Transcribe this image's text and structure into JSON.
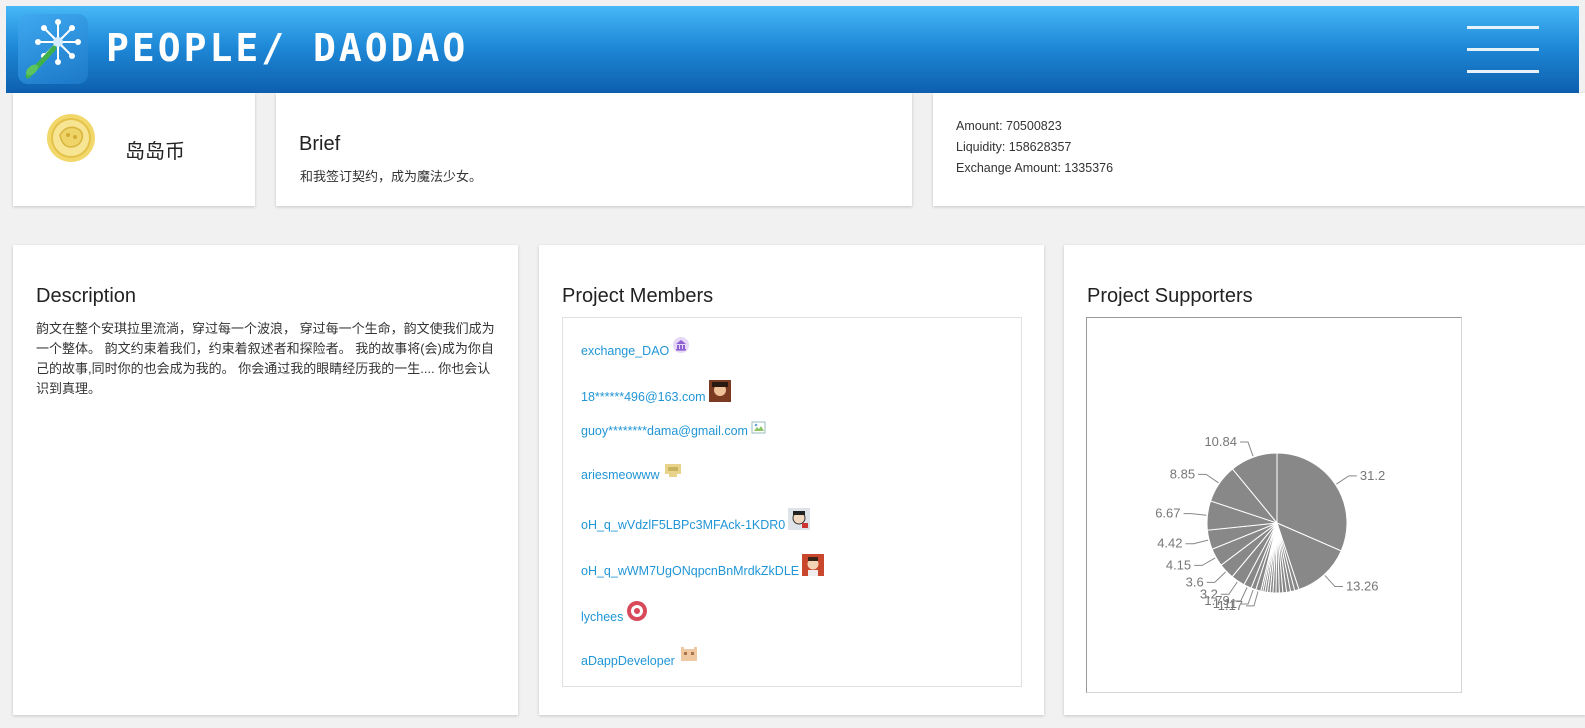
{
  "header": {
    "title": "PEOPLE/ DAODAO",
    "logo_icon": "dandelion-logo-icon",
    "menu_icon": "hamburger-menu-icon"
  },
  "token": {
    "name": "岛岛币",
    "icon": "coin-icon"
  },
  "brief": {
    "title": "Brief",
    "text": "和我签订契约，成为魔法少女。"
  },
  "stats": {
    "amount": "Amount: 70500823",
    "liquidity": "Liquidity: 158628357",
    "exchange_amount": "Exchange Amount: 1335376"
  },
  "description": {
    "title": "Description",
    "text": "韵文在整个安琪拉里流淌，穿过每一个波浪， 穿过每一个生命，韵文使我们成为一个整体。 韵文约束着我们，约束着叙述者和探险者。 我的故事将(会)成为你自己的故事,同时你的也会成为我的。 你会通过我的眼睛经历我的一生.... 你也会认识到真理。"
  },
  "members": {
    "title": "Project Members",
    "items": [
      {
        "name": "exchange_DAO",
        "avatar": "bank-icon"
      },
      {
        "name": "18******496@163.com",
        "avatar": "avatar-portrait-icon"
      },
      {
        "name": "guoy********dama@gmail.com",
        "avatar": "broken-image-icon"
      },
      {
        "name": "ariesmeowww",
        "avatar": "pixel-avatar-icon"
      },
      {
        "name": "oH_q_wVdzlF5LBPc3MFAck-1KDR0",
        "avatar": "avatar-portrait-icon"
      },
      {
        "name": "oH_q_wWM7UgONqpcnBnMrdkZkDLE",
        "avatar": "avatar-portrait-icon"
      },
      {
        "name": "lychees",
        "avatar": "avatar-portrait-icon"
      },
      {
        "name": "aDappDeveloper",
        "avatar": "pixel-avatar-icon"
      }
    ]
  },
  "supporters": {
    "title": "Project Supporters"
  },
  "colors": {
    "header_top": "#48b8f7",
    "header_bottom": "#0d5fae",
    "link": "#2196d6",
    "pie_fill": "#888888"
  },
  "chart_data": {
    "type": "pie",
    "title": "Project Supporters",
    "values": [
      31.2,
      13.26,
      1.0,
      0.95,
      0.9,
      0.85,
      0.8,
      0.75,
      0.7,
      0.65,
      0.6,
      0.55,
      0.5,
      0.45,
      1.17,
      1.11,
      1.79,
      3.2,
      3.6,
      4.15,
      4.42,
      6.67,
      8.85,
      10.84
    ],
    "labels": [
      "31.2",
      "13.26",
      "",
      "",
      "",
      "",
      "",
      "",
      "",
      "",
      "",
      "",
      "",
      "",
      "1.17",
      "1.11",
      "1.79",
      "3.2",
      "3.6",
      "4.15",
      "4.42",
      "6.67",
      "8.85",
      "10.84"
    ],
    "fill": "#888888"
  }
}
